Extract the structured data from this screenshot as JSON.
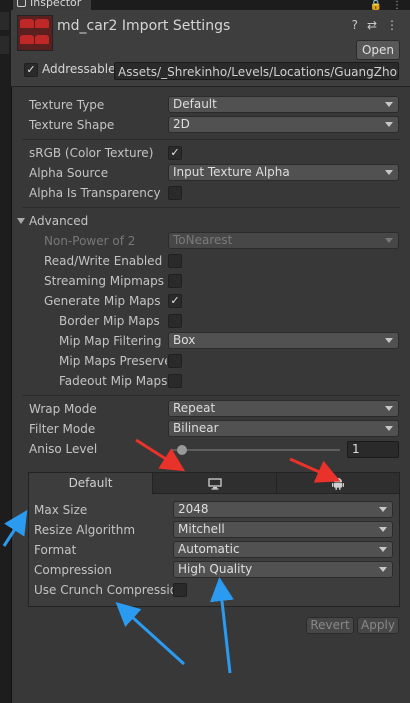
{
  "window": {
    "tab_title": "Inspector"
  },
  "header": {
    "title": "md_car2 Import Settings",
    "open_label": "Open",
    "addressable_label": "Addressable",
    "addressable_checked": true,
    "addressable_path": "Assets/_Shrekinho/Levels/Locations/GuangZhouL"
  },
  "settings": {
    "texture_type": {
      "label": "Texture Type",
      "value": "Default"
    },
    "texture_shape": {
      "label": "Texture Shape",
      "value": "2D"
    },
    "srgb": {
      "label": "sRGB (Color Texture)",
      "checked": true
    },
    "alpha_source": {
      "label": "Alpha Source",
      "value": "Input Texture Alpha"
    },
    "alpha_transparency": {
      "label": "Alpha Is Transparency",
      "checked": false
    }
  },
  "advanced": {
    "label": "Advanced",
    "npot": {
      "label": "Non-Power of 2",
      "value": "ToNearest"
    },
    "read_write": {
      "label": "Read/Write Enabled",
      "checked": false
    },
    "streaming_mipmaps": {
      "label": "Streaming Mipmaps",
      "checked": false
    },
    "generate_mipmaps": {
      "label": "Generate Mip Maps",
      "checked": true
    },
    "border_mipmaps": {
      "label": "Border Mip Maps",
      "checked": false
    },
    "mip_filtering": {
      "label": "Mip Map Filtering",
      "value": "Box"
    },
    "mip_preserve": {
      "label": "Mip Maps Preserve",
      "checked": false
    },
    "fadeout_mipmaps": {
      "label": "Fadeout Mip Maps",
      "checked": false
    }
  },
  "wrap_mode": {
    "label": "Wrap Mode",
    "value": "Repeat"
  },
  "filter_mode": {
    "label": "Filter Mode",
    "value": "Bilinear"
  },
  "aniso_level": {
    "label": "Aniso Level",
    "value": "1",
    "slider_fraction": 0.06
  },
  "platforms": {
    "tabs": [
      {
        "label": "Default",
        "active": true
      },
      {
        "icon": "monitor-icon",
        "active": false
      },
      {
        "icon": "android-icon",
        "active": false
      }
    ],
    "max_size": {
      "label": "Max Size",
      "value": "2048"
    },
    "resize_algorithm": {
      "label": "Resize Algorithm",
      "value": "Mitchell"
    },
    "format": {
      "label": "Format",
      "value": "Automatic"
    },
    "compression": {
      "label": "Compression",
      "value": "High Quality"
    },
    "crunch": {
      "label": "Use Crunch Compression",
      "checked": false
    }
  },
  "footer": {
    "revert_label": "Revert",
    "apply_label": "Apply"
  },
  "annotation_colors": {
    "red": "#e8322a",
    "blue": "#2a9bf0"
  }
}
